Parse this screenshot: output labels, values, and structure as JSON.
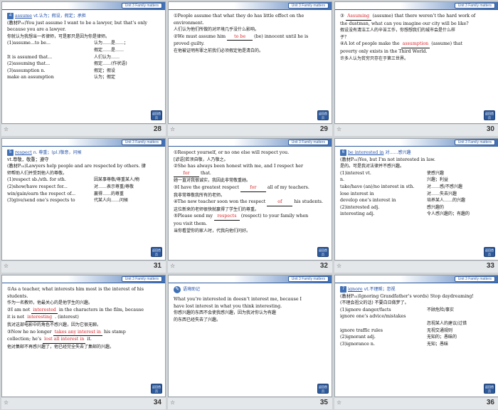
{
  "header_tag": "Unit 3   Family matters",
  "nav_badge": "返回首页",
  "star": "☆",
  "slides": [
    {
      "page": "28",
      "lines": [
        {
          "icon": "4",
          "kw": "assume",
          "pos": "vt.认为；假设，假定；承担"
        },
        {
          "text": "(教材P₃₃)You just assume I want to be a lawyer, but that’s only"
        },
        {
          "text": "because you are a lawyer."
        },
        {
          "zh": "你就认为我想当一名律师，可是那只是因为你是律师。"
        },
        {
          "a": "(1)assume...to be...",
          "b": "认为……是……；"
        },
        {
          "a": "",
          "b": "假定……是……"
        },
        {
          "a": "It is assumed that...",
          "b": "人们认为……"
        },
        {
          "a": "(2)assuming that...",
          "b": "假定……(作状语)"
        },
        {
          "a": "(3)assumption n.",
          "b": "假定；假设"
        },
        {
          "a": "make an assumption",
          "b": "认为；假定"
        }
      ]
    },
    {
      "page": "29",
      "lines": [
        {
          "text": "①People assume that what they do has little effect on the"
        },
        {
          "text": "environment."
        },
        {
          "zh": "人们认为他们所做的对环境几乎没什么影响。"
        },
        {
          "pre": "②We must assume him",
          "blank": "to be",
          "post": "(be) innocent until he is"
        },
        {
          "text": "proved guilty."
        },
        {
          "zh": "在他被证明有罪之前我们必须假定他是清白的。"
        }
      ]
    },
    {
      "page": "30",
      "lines": [
        {
          "pre": "③",
          "blank": "Assuming",
          "post": "(assume) that there weren’t the hard work of"
        },
        {
          "text": "the dustman, what can you imagine our city will be like?"
        },
        {
          "zh": "假设没有清洁工人的辛苦工作，你想想我们的城市会是什么样"
        },
        {
          "zh": "子？"
        },
        {
          "pre": "④A lot of people make the",
          "blank": "assumption",
          "post": "(assume) that"
        },
        {
          "text": "poverty only exists in the Third World."
        },
        {
          "zh": "许多人认为贫穷只存在于第三世界。"
        }
      ]
    },
    {
      "page": "31",
      "lines": [
        {
          "icon": "5",
          "kw": "respect",
          "pos": "n.  尊重；(pl.)敬意，问候"
        },
        {
          "text": "              vt.尊敬，敬重；遵守"
        },
        {
          "text": "(教材P₃₃)Lawyers help people and are respected by others.  律"
        },
        {
          "zh": "师帮助人们并受到他人的尊敬。"
        },
        {
          "a": "(1)respect sb./sth. for sth.",
          "b": "因某事尊敬/尊重某人/物"
        },
        {
          "a": "(2)show/have respect for...",
          "b": "对……表示尊重/尊敬"
        },
        {
          "a": "win/gain/earn the respect of...",
          "b": "赢得……的尊重"
        },
        {
          "a": "(3)give/send one’s respects to",
          "b": "代某人向……问候"
        }
      ]
    },
    {
      "page": "32",
      "lines": [
        {
          "text": "①Respect yourself, or no one else will respect you."
        },
        {
          "zh": "[谚语]若须自敬，人乃敬之。"
        },
        {
          "text": "②She has always been honest with me, and I respect her"
        },
        {
          "pre": "",
          "blank": "for",
          "post": "that."
        },
        {
          "zh": "她一直对我很诚实，我因此非常敬重她。"
        },
        {
          "pre": "③I have the greatest respect",
          "blank": "for",
          "post": "all of my teachers."
        },
        {
          "zh": "我非常尊敬我所有的老师。"
        },
        {
          "pre": "④The new teacher soon won the respect",
          "blank": "of",
          "post": "his students."
        },
        {
          "zh": "这位新来的老师很快就赢得了学生们的尊重。"
        },
        {
          "pre": "⑤Please send my",
          "blank": "respects",
          "post": "(respect) to your family when"
        },
        {
          "text": "you visit them."
        },
        {
          "zh": "当你看望你的家人时，代我向他们问好。"
        }
      ]
    },
    {
      "page": "33",
      "lines": [
        {
          "icon": "6",
          "kw": "be interested in",
          "pos": "对……感兴趣"
        },
        {
          "text": "(教材P₃₃)Yes, but I’m not interested in law."
        },
        {
          "zh": "是的。可是我对法律并不感兴趣。"
        },
        {
          "a": "(1)interest vt.",
          "b": "使感兴趣"
        },
        {
          "a": "n.",
          "b": "兴趣；利益"
        },
        {
          "a": "take/have (an)/no interest in sth.",
          "b": "对……感/不感兴趣"
        },
        {
          "a": "lose interest in",
          "b": "对……失去兴趣"
        },
        {
          "a": "develop one’s interest in",
          "b": "培养某人……的兴趣"
        },
        {
          "a": "(2)interested adj.",
          "b": "感兴趣的"
        },
        {
          "a": "interesting adj.",
          "b": "令人感兴趣的；有趣的"
        }
      ]
    },
    {
      "page": "34",
      "lines": [
        {
          "text": "①As a teacher, what interests him most is the interest of his"
        },
        {
          "text": "students."
        },
        {
          "zh": "作为一名教师，他最关心的是他学生的兴趣。"
        },
        {
          "pre": "②I am not",
          "blank": "interested",
          "post": "in the characters in the film, because"
        },
        {
          "pre": "it is not",
          "blank": "interesting",
          "post": ". (interest)"
        },
        {
          "zh": "我对这部电影中的角色不感兴趣，因为它很无聊。"
        },
        {
          "pre": "③Now he no longer",
          "blank": "takes any interest in",
          "post": "his stamp"
        },
        {
          "pre": "collection; he’s",
          "blank": "lost all interest in",
          "post": "it."
        },
        {
          "zh": "他对集邮不再感兴趣了，他已经完全失去了集邮的兴趣。"
        }
      ]
    },
    {
      "page": "35",
      "tip": "语境助记",
      "lines": [
        {
          "text": "    What you’re interested in doesn’t interest me, because I"
        },
        {
          "text": "have lost interest in what you think interesting."
        },
        {
          "zh": "    你感兴趣的东西不会使我感兴趣，因为我对你认为有趣"
        },
        {
          "zh": "的东西已经失去了兴趣。"
        }
      ]
    },
    {
      "page": "36",
      "lines": [
        {
          "icon": "7",
          "kw": "ignore",
          "pos": "vt.不理睬；忽视"
        },
        {
          "text": "(教材P₃₃)Ignoring Grandfather’s words) Stop daydreaming!"
        },
        {
          "zh": "(不理会祖父的话) 不要白日做梦了。"
        },
        {
          "a": "(1)ignore danger/facts",
          "b": "不顾危险/事实"
        },
        {
          "a": "ignore one’s advice/mistakes",
          "b": ""
        },
        {
          "a": "",
          "b": "忽视某人的建议/过错"
        },
        {
          "a": "ignore traffic rules",
          "b": "无视交通规则"
        },
        {
          "a": "(2)ignorant adj.",
          "b": "无知的；愚昧的"
        },
        {
          "a": "(3)ignorance n.",
          "b": "无知；愚昧"
        }
      ]
    }
  ]
}
